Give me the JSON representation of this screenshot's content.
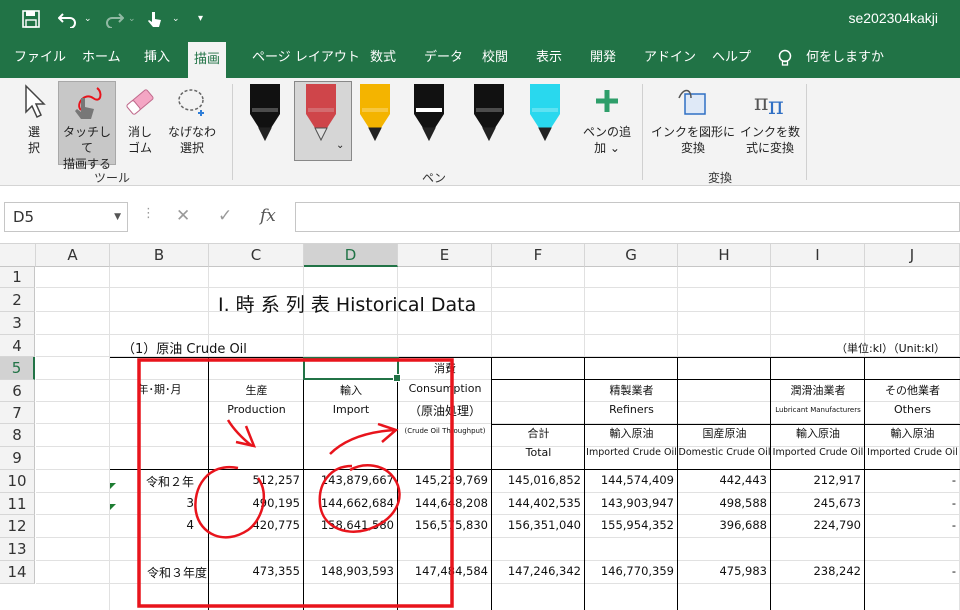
{
  "window": {
    "doc_title": "se202304kakji"
  },
  "tabs": [
    "ファイル",
    "ホーム",
    "挿入",
    "描画",
    "ページ レイアウト",
    "数式",
    "データ",
    "校閲",
    "表示",
    "開発",
    "アドイン",
    "ヘルプ",
    "何をしますか"
  ],
  "ribbon": {
    "select": "選\n択",
    "touch_draw": "タッチして\n描画する",
    "eraser": "消し\nゴム",
    "lasso": "なげなわ\n選択",
    "tools_group": "ツール",
    "add_pen": "ペンの追\n加 ⌄",
    "pens_group": "ペン",
    "ink_to_shape": "インクを図形に\n変換",
    "ink_to_math": "インクを数\n式に変換",
    "convert_group": "変換",
    "pen_colors": [
      "#111111",
      "#e8141c",
      "#f4b400",
      "#111111",
      "#111111",
      "#29d8ee"
    ]
  },
  "formula_bar": {
    "name_box": "D5",
    "cancel": "✕",
    "enter": "✓",
    "fx": "fx",
    "value": ""
  },
  "columns": [
    "A",
    "B",
    "C",
    "D",
    "E",
    "F",
    "G",
    "H",
    "I",
    "J"
  ],
  "rows": [
    "1",
    "2",
    "3",
    "4",
    "5",
    "6",
    "7",
    "8",
    "9",
    "10",
    "11",
    "12",
    "13",
    "14"
  ],
  "sheet": {
    "title": "Ⅰ. 時 系 列 表  Historical Data",
    "subtitle": "（1）原油  Crude Oil",
    "unit": "（単位:kl）（Unit:kl）",
    "h_consume": "消費",
    "h_period": "年･期･月",
    "h_production_jp": "生産",
    "h_production_en": "Production",
    "h_import_jp": "輸入",
    "h_import_en": "Import",
    "h_consumption_en": "Consumption",
    "h_throughput_jp": "（原油処理）",
    "h_throughput_en": "(Crude Oil Throughput)",
    "h_refiners_jp": "精製業者",
    "h_refiners_en": "Refiners",
    "h_lube_jp": "潤滑油業者",
    "h_lube_en": "Lubricant Manufacturers",
    "h_others_jp": "その他業者",
    "h_others_en": "Others",
    "h_total_jp": "合計",
    "h_total_en": "Total",
    "h_imported_jp": "輸入原油",
    "h_imported_en": "Imported Crude Oil",
    "h_domestic_jp": "国産原油",
    "h_domestic_en": "Domestic Crude Oil",
    "r10": {
      "period": "令和２年",
      "prod": "512,257",
      "imp": "143,879,667",
      "cons": "145,229,769",
      "total": "145,016,852",
      "ref_imp": "144,574,409",
      "dom": "442,443",
      "lube": "212,917",
      "oth": "-"
    },
    "r11": {
      "period": "3",
      "prod": "490,195",
      "imp": "144,662,684",
      "cons": "144,648,208",
      "total": "144,402,535",
      "ref_imp": "143,903,947",
      "dom": "498,588",
      "lube": "245,673",
      "oth": "-"
    },
    "r12": {
      "period": "4",
      "prod": "420,775",
      "imp": "158,641,580",
      "cons": "156,575,830",
      "total": "156,351,040",
      "ref_imp": "155,954,352",
      "dom": "396,688",
      "lube": "224,790",
      "oth": "-"
    },
    "r14": {
      "period": "令和３年度",
      "prod": "473,355",
      "imp": "148,903,593",
      "cons": "147,484,584",
      "total": "147,246,342",
      "ref_imp": "146,770,359",
      "dom": "475,983",
      "lube": "238,242",
      "oth": "-"
    }
  },
  "colors": {
    "excel_green": "#217346",
    "ink_red": "#e8141c"
  }
}
